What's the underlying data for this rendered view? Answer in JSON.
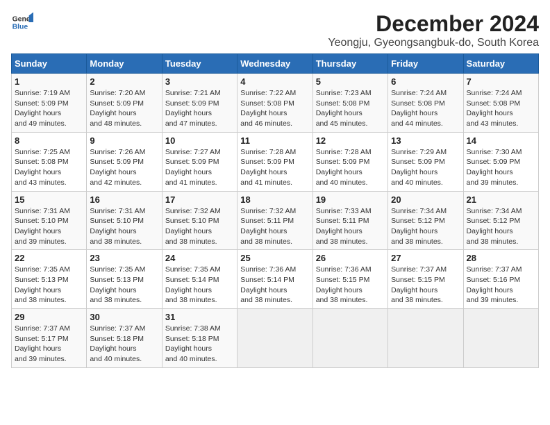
{
  "logo": {
    "line1": "General",
    "line2": "Blue"
  },
  "title": "December 2024",
  "location": "Yeongju, Gyeongsangbuk-do, South Korea",
  "weekdays": [
    "Sunday",
    "Monday",
    "Tuesday",
    "Wednesday",
    "Thursday",
    "Friday",
    "Saturday"
  ],
  "weeks": [
    [
      {
        "day": "1",
        "sunrise": "7:19 AM",
        "sunset": "5:09 PM",
        "daylight": "9 hours and 49 minutes."
      },
      {
        "day": "2",
        "sunrise": "7:20 AM",
        "sunset": "5:09 PM",
        "daylight": "9 hours and 48 minutes."
      },
      {
        "day": "3",
        "sunrise": "7:21 AM",
        "sunset": "5:09 PM",
        "daylight": "9 hours and 47 minutes."
      },
      {
        "day": "4",
        "sunrise": "7:22 AM",
        "sunset": "5:08 PM",
        "daylight": "9 hours and 46 minutes."
      },
      {
        "day": "5",
        "sunrise": "7:23 AM",
        "sunset": "5:08 PM",
        "daylight": "9 hours and 45 minutes."
      },
      {
        "day": "6",
        "sunrise": "7:24 AM",
        "sunset": "5:08 PM",
        "daylight": "9 hours and 44 minutes."
      },
      {
        "day": "7",
        "sunrise": "7:24 AM",
        "sunset": "5:08 PM",
        "daylight": "9 hours and 43 minutes."
      }
    ],
    [
      {
        "day": "8",
        "sunrise": "7:25 AM",
        "sunset": "5:08 PM",
        "daylight": "9 hours and 43 minutes."
      },
      {
        "day": "9",
        "sunrise": "7:26 AM",
        "sunset": "5:09 PM",
        "daylight": "9 hours and 42 minutes."
      },
      {
        "day": "10",
        "sunrise": "7:27 AM",
        "sunset": "5:09 PM",
        "daylight": "9 hours and 41 minutes."
      },
      {
        "day": "11",
        "sunrise": "7:28 AM",
        "sunset": "5:09 PM",
        "daylight": "9 hours and 41 minutes."
      },
      {
        "day": "12",
        "sunrise": "7:28 AM",
        "sunset": "5:09 PM",
        "daylight": "9 hours and 40 minutes."
      },
      {
        "day": "13",
        "sunrise": "7:29 AM",
        "sunset": "5:09 PM",
        "daylight": "9 hours and 40 minutes."
      },
      {
        "day": "14",
        "sunrise": "7:30 AM",
        "sunset": "5:09 PM",
        "daylight": "9 hours and 39 minutes."
      }
    ],
    [
      {
        "day": "15",
        "sunrise": "7:31 AM",
        "sunset": "5:10 PM",
        "daylight": "9 hours and 39 minutes."
      },
      {
        "day": "16",
        "sunrise": "7:31 AM",
        "sunset": "5:10 PM",
        "daylight": "9 hours and 38 minutes."
      },
      {
        "day": "17",
        "sunrise": "7:32 AM",
        "sunset": "5:10 PM",
        "daylight": "9 hours and 38 minutes."
      },
      {
        "day": "18",
        "sunrise": "7:32 AM",
        "sunset": "5:11 PM",
        "daylight": "9 hours and 38 minutes."
      },
      {
        "day": "19",
        "sunrise": "7:33 AM",
        "sunset": "5:11 PM",
        "daylight": "9 hours and 38 minutes."
      },
      {
        "day": "20",
        "sunrise": "7:34 AM",
        "sunset": "5:12 PM",
        "daylight": "9 hours and 38 minutes."
      },
      {
        "day": "21",
        "sunrise": "7:34 AM",
        "sunset": "5:12 PM",
        "daylight": "9 hours and 38 minutes."
      }
    ],
    [
      {
        "day": "22",
        "sunrise": "7:35 AM",
        "sunset": "5:13 PM",
        "daylight": "9 hours and 38 minutes."
      },
      {
        "day": "23",
        "sunrise": "7:35 AM",
        "sunset": "5:13 PM",
        "daylight": "9 hours and 38 minutes."
      },
      {
        "day": "24",
        "sunrise": "7:35 AM",
        "sunset": "5:14 PM",
        "daylight": "9 hours and 38 minutes."
      },
      {
        "day": "25",
        "sunrise": "7:36 AM",
        "sunset": "5:14 PM",
        "daylight": "9 hours and 38 minutes."
      },
      {
        "day": "26",
        "sunrise": "7:36 AM",
        "sunset": "5:15 PM",
        "daylight": "9 hours and 38 minutes."
      },
      {
        "day": "27",
        "sunrise": "7:37 AM",
        "sunset": "5:15 PM",
        "daylight": "9 hours and 38 minutes."
      },
      {
        "day": "28",
        "sunrise": "7:37 AM",
        "sunset": "5:16 PM",
        "daylight": "9 hours and 39 minutes."
      }
    ],
    [
      {
        "day": "29",
        "sunrise": "7:37 AM",
        "sunset": "5:17 PM",
        "daylight": "9 hours and 39 minutes."
      },
      {
        "day": "30",
        "sunrise": "7:37 AM",
        "sunset": "5:18 PM",
        "daylight": "9 hours and 40 minutes."
      },
      {
        "day": "31",
        "sunrise": "7:38 AM",
        "sunset": "5:18 PM",
        "daylight": "9 hours and 40 minutes."
      },
      null,
      null,
      null,
      null
    ]
  ],
  "labels": {
    "sunrise": "Sunrise:",
    "sunset": "Sunset:",
    "daylight": "Daylight hours"
  }
}
